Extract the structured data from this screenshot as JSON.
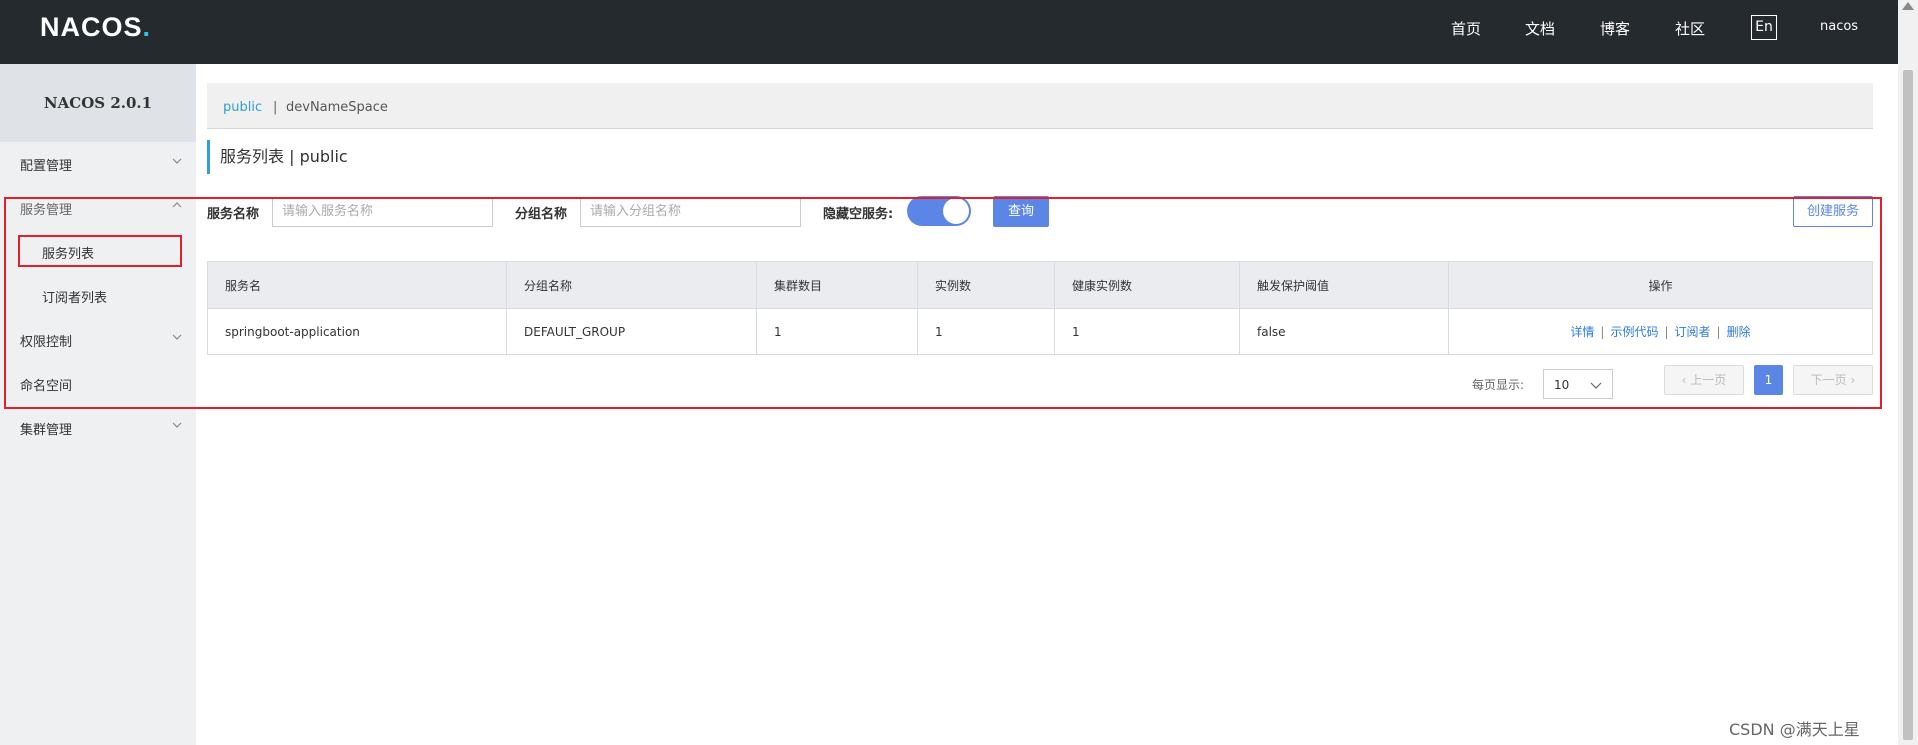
{
  "header": {
    "logo_text": "NACOS",
    "logo_dot": ".",
    "nav": [
      "首页",
      "文档",
      "博客",
      "社区"
    ],
    "lang": "En",
    "user": "nacos"
  },
  "sidebar": {
    "title": "NACOS 2.0.1",
    "items": [
      {
        "label": "配置管理"
      },
      {
        "label": "服务管理"
      },
      {
        "label": "服务列表"
      },
      {
        "label": "订阅者列表"
      },
      {
        "label": "权限控制"
      },
      {
        "label": "命名空间"
      },
      {
        "label": "集群管理"
      }
    ]
  },
  "namespace_bar": {
    "active": "public",
    "separator": "|",
    "other": "devNameSpace"
  },
  "page": {
    "title": "服务列表  |  public"
  },
  "filters": {
    "service_name_label": "服务名称",
    "service_name_placeholder": "请输入服务名称",
    "group_name_label": "分组名称",
    "group_name_placeholder": "请输入分组名称",
    "hide_empty_label": "隐藏空服务:",
    "hide_empty_enabled": true,
    "query_button": "查询",
    "create_button": "创建服务"
  },
  "table": {
    "columns": [
      "服务名",
      "分组名称",
      "集群数目",
      "实例数",
      "健康实例数",
      "触发保护阈值",
      "操作"
    ],
    "rows": [
      {
        "service": "springboot-application",
        "group": "DEFAULT_GROUP",
        "clusters": "1",
        "instances": "1",
        "healthy": "1",
        "threshold": "false",
        "ops": [
          "详情",
          "示例代码",
          "订阅者",
          "删除"
        ]
      }
    ]
  },
  "pagination": {
    "per_page_label": "每页显示:",
    "per_page_value": "10",
    "prev": "上一页",
    "current": "1",
    "next": "下一页"
  },
  "watermark": "CSDN @满天上星",
  "colors": {
    "topbar": "#252a2f",
    "accent": "#5b86e5",
    "link": "#2d7be0",
    "highlight_border": "#e0202a"
  }
}
